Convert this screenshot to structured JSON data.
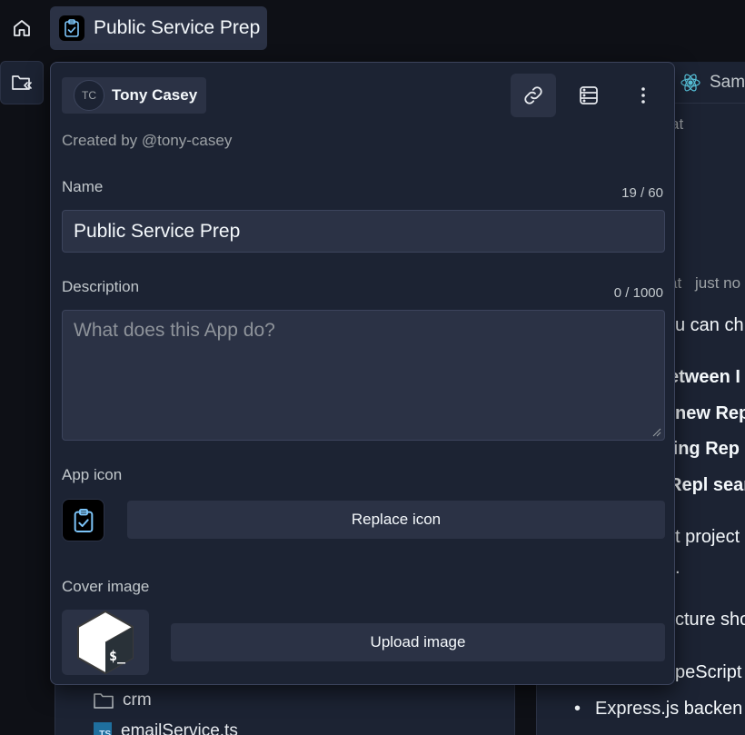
{
  "workspace": {
    "app_title": "Public Service Prep"
  },
  "background": {
    "files": [
      {
        "name": "crm",
        "type": "folder"
      },
      {
        "name": "emailService.ts",
        "type": "ts",
        "badge": "TS"
      }
    ],
    "chat": {
      "tab_label": "Sam",
      "fragments": [
        "at",
        "at",
        "just no",
        "u can ch",
        "etween I",
        "new Rep",
        "ting Rep",
        "Repl sear",
        "t project",
        ".",
        "cture sho",
        "peScript",
        "Express.js backen"
      ]
    }
  },
  "modal": {
    "owner": {
      "initials": "TC",
      "name": "Tony Casey"
    },
    "created_by": "Created by @tony-casey",
    "name_field": {
      "label": "Name",
      "counter": "19 / 60",
      "value": "Public Service Prep"
    },
    "description_field": {
      "label": "Description",
      "counter": "0 / 1000",
      "placeholder": "What does this App do?"
    },
    "app_icon": {
      "label": "App icon",
      "button": "Replace icon"
    },
    "cover_image": {
      "label": "Cover image",
      "button": "Upload image",
      "glyph": "$_"
    }
  },
  "colors": {
    "background": "#0e1016",
    "surface": "#1c2333",
    "surface_raised": "#2b3245",
    "border": "#3c445c",
    "icon_accent": "#7cc4f8",
    "react_blue": "#58c4dc"
  }
}
